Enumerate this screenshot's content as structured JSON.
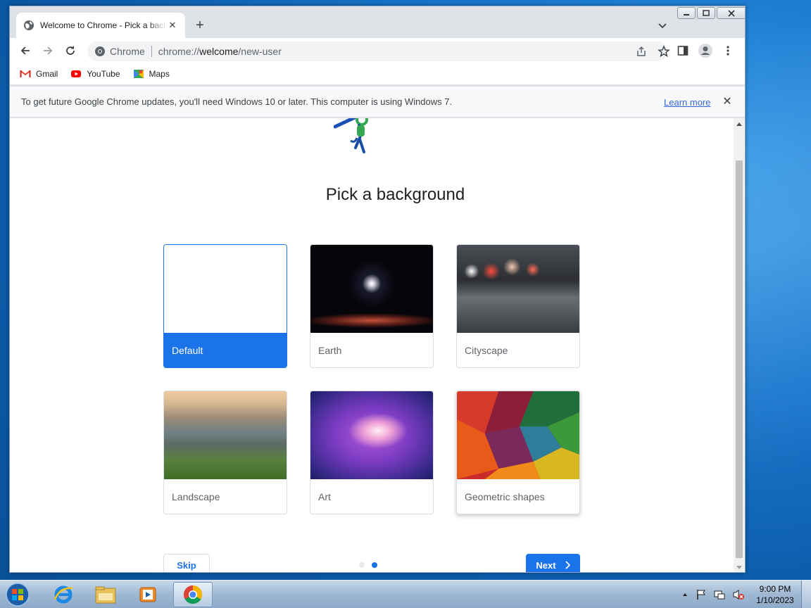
{
  "browser": {
    "tab": {
      "title": "Welcome to Chrome - Pick a background",
      "favicon": "globe-icon"
    },
    "omnibox": {
      "site_label": "Chrome",
      "url_prefix": "chrome://",
      "url_host": "welcome",
      "url_path": "/new-user"
    },
    "bookmarks": [
      {
        "label": "Gmail",
        "icon": "gmail-icon"
      },
      {
        "label": "YouTube",
        "icon": "youtube-icon"
      },
      {
        "label": "Maps",
        "icon": "maps-icon"
      }
    ],
    "infobar": {
      "message": "To get future Google Chrome updates, you'll need Windows 10 or later. This computer is using Windows 7.",
      "link": "Learn more"
    }
  },
  "page": {
    "heading": "Pick a background",
    "backgrounds": [
      {
        "label": "Default",
        "selected": true
      },
      {
        "label": "Earth",
        "selected": false
      },
      {
        "label": "Cityscape",
        "selected": false
      },
      {
        "label": "Landscape",
        "selected": false
      },
      {
        "label": "Art",
        "selected": false
      },
      {
        "label": "Geometric shapes",
        "selected": false
      }
    ],
    "skip_label": "Skip",
    "next_label": "Next",
    "step_current": 2,
    "step_total": 2
  },
  "taskbar": {
    "clock_time": "9:00 PM",
    "clock_date": "1/10/2023"
  },
  "colors": {
    "accent": "#1a73e8",
    "desktop": "#1a78cf"
  }
}
